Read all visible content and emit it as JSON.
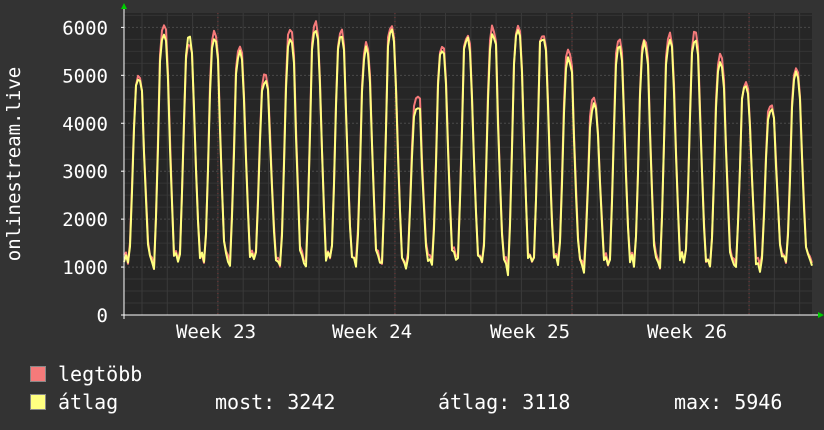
{
  "chart_data": {
    "type": "line",
    "title": "",
    "xlabel": "",
    "ylabel": "onlinestream.live",
    "ylim": [
      0,
      6300
    ],
    "yticks": [
      0,
      1000,
      2000,
      3000,
      4000,
      5000,
      6000
    ],
    "xtick_labels": [
      "Week 23",
      "Week 24",
      "Week 25",
      "Week 26"
    ],
    "grid": true,
    "days": 31,
    "series": [
      {
        "name": "legtöbb",
        "color": "#f57a7a",
        "daily_peak": [
          5000,
          6100,
          5700,
          5950,
          5600,
          5050,
          6000,
          6100,
          5950,
          5650,
          6050,
          4550,
          5650,
          5850,
          6000,
          6050,
          5850,
          5550,
          4550,
          5750,
          5800,
          5850,
          5900,
          5450,
          4850,
          4400,
          5200
        ],
        "daily_trough": [
          1000,
          950,
          1000,
          950,
          1000,
          1050,
          900,
          950,
          1050,
          950,
          950,
          900,
          950,
          1050,
          950,
          900,
          950,
          1000,
          950,
          900,
          950,
          950,
          1000,
          900,
          950,
          900,
          1000
        ]
      },
      {
        "name": "átlag",
        "color": "#ffff80",
        "daily_peak": [
          4950,
          5900,
          5800,
          5800,
          5500,
          4900,
          5800,
          5950,
          5850,
          5550,
          5950,
          4350,
          5550,
          5750,
          5850,
          5950,
          5750,
          5350,
          4400,
          5600,
          5700,
          5750,
          5750,
          5300,
          4800,
          4300,
          5050
        ],
        "daily_trough": [
          950,
          900,
          950,
          950,
          950,
          1000,
          850,
          900,
          1000,
          900,
          900,
          850,
          900,
          1000,
          900,
          850,
          900,
          950,
          900,
          850,
          900,
          900,
          950,
          850,
          900,
          850,
          950
        ]
      }
    ]
  },
  "legend": {
    "max_label": "legtöbb",
    "avg_label": "átlag",
    "stat_now": "most: 3242",
    "stat_avg": "átlag: 3118",
    "stat_max": "max: 5946"
  },
  "colors": {
    "background": "#333333",
    "plot_background": "#262626",
    "grid": "#3e3e3e",
    "axis": "#ffffff",
    "arrow": "#00cc00"
  }
}
